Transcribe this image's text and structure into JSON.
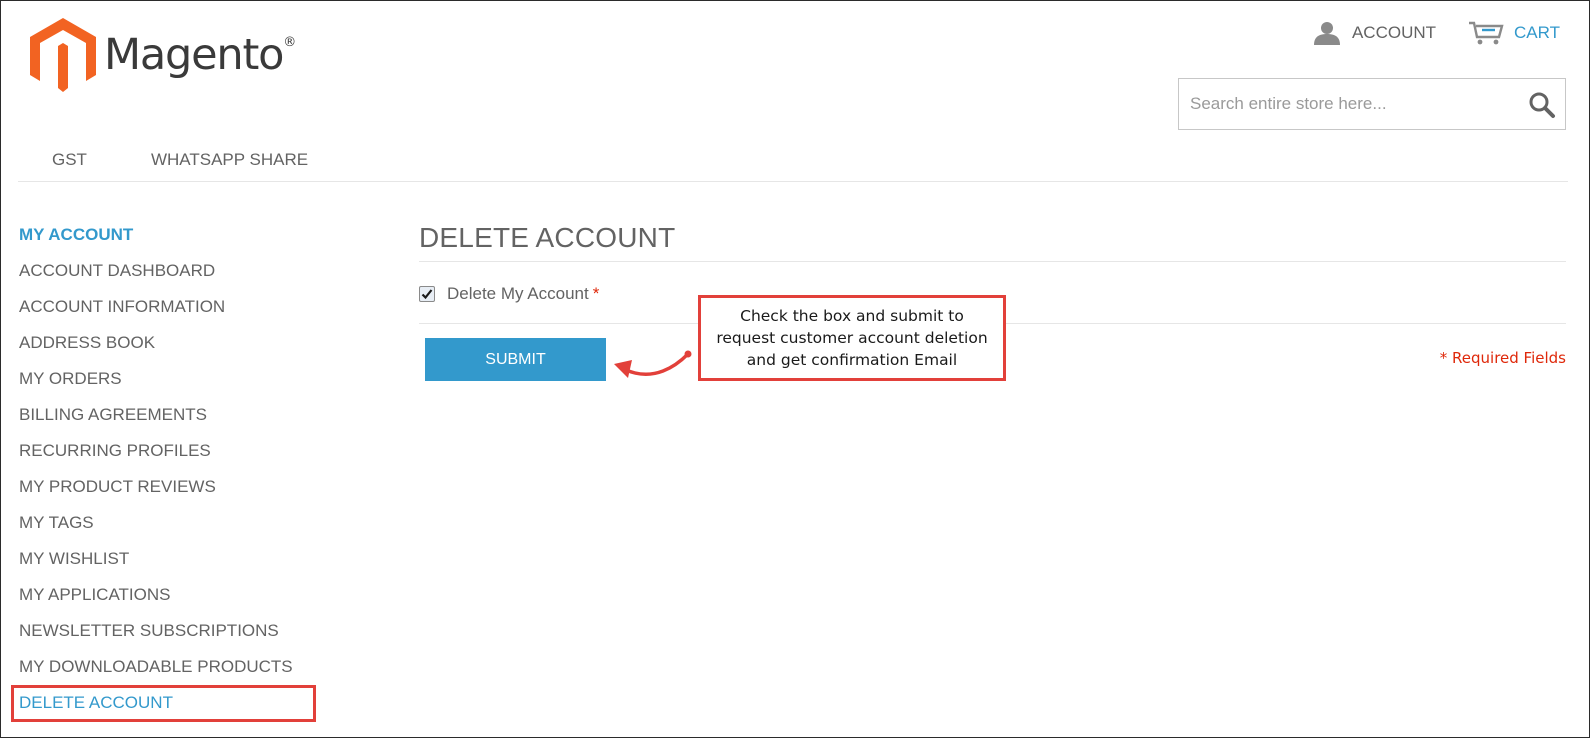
{
  "header": {
    "logo_text": "Magento",
    "logo_mark": "®",
    "account_label": "ACCOUNT",
    "cart_label": "CART",
    "search_placeholder": "Search entire store here..."
  },
  "nav": {
    "items": [
      "GST",
      "WHATSAPP SHARE"
    ]
  },
  "sidebar": {
    "title": "MY ACCOUNT",
    "items": [
      {
        "label": "ACCOUNT DASHBOARD"
      },
      {
        "label": "ACCOUNT INFORMATION"
      },
      {
        "label": "ADDRESS BOOK"
      },
      {
        "label": "MY ORDERS"
      },
      {
        "label": "BILLING AGREEMENTS"
      },
      {
        "label": "RECURRING PROFILES"
      },
      {
        "label": "MY PRODUCT REVIEWS"
      },
      {
        "label": "MY TAGS"
      },
      {
        "label": "MY WISHLIST"
      },
      {
        "label": "MY APPLICATIONS"
      },
      {
        "label": "NEWSLETTER SUBSCRIPTIONS"
      },
      {
        "label": "MY DOWNLOADABLE PRODUCTS"
      },
      {
        "label": "DELETE ACCOUNT",
        "active": true
      }
    ]
  },
  "main": {
    "page_title": "DELETE ACCOUNT",
    "checkbox_label": "Delete My Account",
    "checkbox_checked": true,
    "required_star": "*",
    "submit_label": "SUBMIT",
    "required_note": "* Required Fields"
  },
  "annotation": {
    "lines": [
      "Check the box and submit to",
      "request customer account deletion",
      "and get confirmation Email"
    ]
  },
  "colors": {
    "accent": "#3399cc",
    "required": "#df280a",
    "annotation": "#e2403a",
    "logo_orange": "#f26322"
  }
}
